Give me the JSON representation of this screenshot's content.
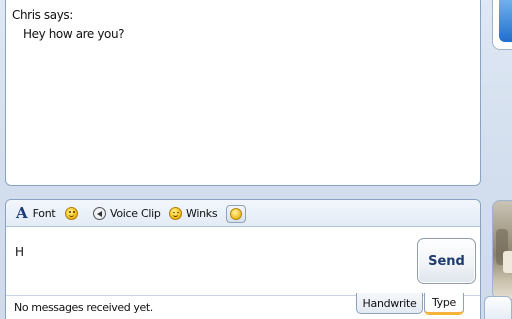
{
  "conversation": {
    "sender_line": "Chris says:",
    "message": "Hey how are you?"
  },
  "toolbar": {
    "font_icon": "A",
    "font_label": "Font",
    "emoticon_icon": "smiley-icon",
    "voice_clip_icon": "voice-clip-icon",
    "voice_clip_label": "Voice Clip",
    "winks_icon": "wink-icon",
    "winks_label": "Winks",
    "nudge_icon": "emoticon-menu-icon"
  },
  "compose": {
    "input_value": "H",
    "send_label": "Send"
  },
  "status": {
    "text": "No messages received yet.",
    "tabs": [
      {
        "label": "Handwrite",
        "selected": false
      },
      {
        "label": "Type",
        "selected": true
      }
    ]
  },
  "colors": {
    "accent_tab_underline": "#f5b43c",
    "border": "#8aa3c3",
    "send_text": "#1f3b6e"
  }
}
